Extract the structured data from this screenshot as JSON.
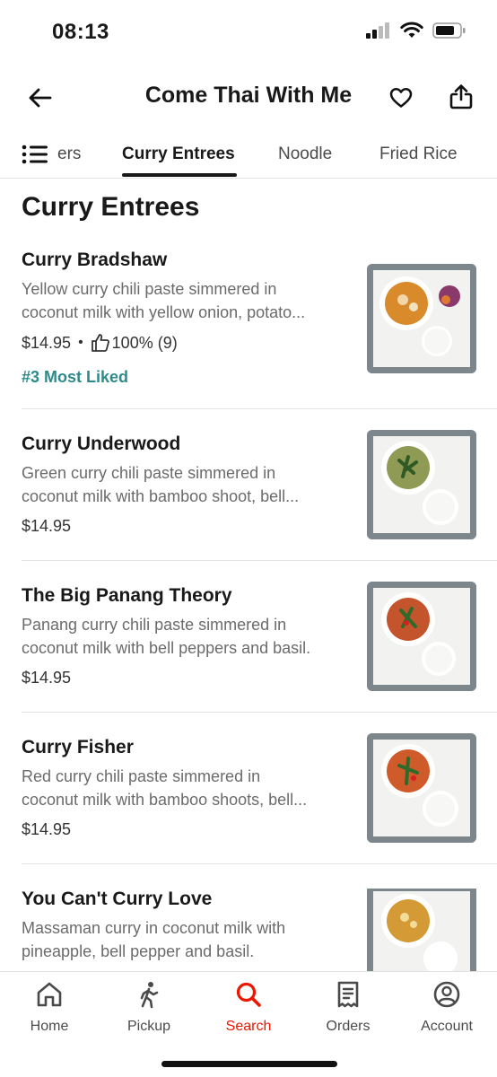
{
  "status_bar": {
    "time": "08:13"
  },
  "header": {
    "title": "Come Thai With Me"
  },
  "tabs": [
    {
      "label": "ers",
      "active": false
    },
    {
      "label": "Curry Entrees",
      "active": true
    },
    {
      "label": "Noodle",
      "active": false
    },
    {
      "label": "Fried Rice",
      "active": false
    }
  ],
  "section": {
    "title": "Curry Entrees"
  },
  "items": [
    {
      "name": "Curry Bradshaw",
      "desc_line1": "Yellow curry chili paste simmered in",
      "desc_line2": "coconut milk with yellow onion, potato...",
      "price": "$14.95",
      "rating": "100% (9)",
      "badge": "#3 Most Liked"
    },
    {
      "name": "Curry Underwood",
      "desc_line1": "Green curry chili paste simmered in",
      "desc_line2": "coconut milk with bamboo shoot, bell...",
      "price": "$14.95"
    },
    {
      "name": "The Big Panang Theory",
      "desc_line1": "Panang curry chili paste simmered in",
      "desc_line2": "coconut milk with bell peppers and basil.",
      "price": "$14.95"
    },
    {
      "name": "Curry Fisher",
      "desc_line1": "Red curry chili paste simmered in",
      "desc_line2": "coconut milk with bamboo shoots, bell...",
      "price": "$14.95"
    },
    {
      "name": "You Can't Curry Love",
      "desc_line1": "Massaman curry in coconut milk with",
      "desc_line2": "pineapple, bell pepper and basil.",
      "price": ""
    }
  ],
  "bottom_nav": [
    {
      "label": "Home",
      "icon": "home-icon",
      "active": false
    },
    {
      "label": "Pickup",
      "icon": "walking-person-icon",
      "active": false
    },
    {
      "label": "Search",
      "icon": "search-icon",
      "active": true
    },
    {
      "label": "Orders",
      "icon": "receipt-icon",
      "active": false
    },
    {
      "label": "Account",
      "icon": "account-icon",
      "active": false
    }
  ],
  "colors": {
    "accent": "#eb1700",
    "badge": "#2e8b8b",
    "text_primary": "#191919",
    "text_secondary": "#6b6b6b"
  }
}
